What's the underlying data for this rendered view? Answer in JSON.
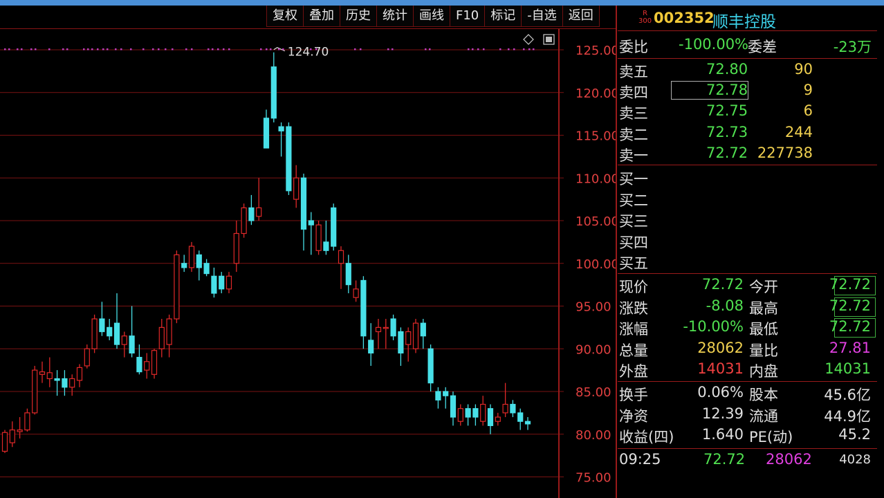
{
  "toolbar": [
    {
      "label": "复权"
    },
    {
      "label": "叠加"
    },
    {
      "label": "历史"
    },
    {
      "label": "统计"
    },
    {
      "label": "画线"
    },
    {
      "label": "F10"
    },
    {
      "label": "标记"
    },
    {
      "label": "-自选"
    },
    {
      "label": "返回"
    }
  ],
  "stock": {
    "badge_top": "R",
    "badge_bottom": "300",
    "code": "002352",
    "name": "顺丰控股"
  },
  "weibi": {
    "label1": "委比",
    "value1": "-100.00%",
    "label2": "委差",
    "value2": "-23万"
  },
  "asks": [
    {
      "label": "卖五",
      "price": "72.80",
      "volume": "90"
    },
    {
      "label": "卖四",
      "price": "72.78",
      "volume": "9"
    },
    {
      "label": "卖三",
      "price": "72.75",
      "volume": "6"
    },
    {
      "label": "卖二",
      "price": "72.73",
      "volume": "244"
    },
    {
      "label": "卖一",
      "price": "72.72",
      "volume": "227738"
    }
  ],
  "bids": [
    {
      "label": "买一"
    },
    {
      "label": "买二"
    },
    {
      "label": "买三"
    },
    {
      "label": "买四"
    },
    {
      "label": "买五"
    }
  ],
  "quote": {
    "xianjia_label": "现价",
    "xianjia": "72.72",
    "jinkai_label": "今开",
    "jinkai": "72.72",
    "zhangdie_label": "涨跌",
    "zhangdie": "-8.08",
    "zuigao_label": "最高",
    "zuigao": "72.72",
    "zhangfu_label": "涨幅",
    "zhangfu": "-10.00%",
    "zuidi_label": "最低",
    "zuidi": "72.72",
    "zongliang_label": "总量",
    "zongliang": "28062",
    "liangbi_label": "量比",
    "liangbi": "27.81",
    "waipan_label": "外盘",
    "waipan": "14031",
    "neipan_label": "内盘",
    "neipan": "14031"
  },
  "fund": {
    "huanshou_label": "换手",
    "huanshou": "0.06%",
    "guben_label": "股本",
    "guben": "45.6亿",
    "jingzi_label": "净资",
    "jingzi": "12.39",
    "liutong_label": "流通",
    "liutong": "44.9亿",
    "shouyi_label": "收益(四)",
    "shouyi": "1.640",
    "pe_label": "PE(动)",
    "pe": "45.2"
  },
  "tick": {
    "time": "09:25",
    "price": "72.72",
    "volume": "28062",
    "count": "4028"
  },
  "colors": {
    "up": "#e02828",
    "down": "#48e0e8",
    "grid": "#7a1212",
    "axis_text": "#e04040",
    "green": "#50e050",
    "yellow": "#f0d050"
  },
  "chart_data": {
    "type": "candlestick",
    "y_ticks": [
      "125.00",
      "120.00",
      "115.00",
      "110.00",
      "105.00",
      "100.00",
      "95.00",
      "90.00",
      "85.00",
      "80.00",
      "75.00"
    ],
    "ylim": [
      72.5,
      127
    ],
    "max_label": "124.70",
    "candles": [
      {
        "o": 78,
        "h": 80.5,
        "l": 77.8,
        "c": 80.2
      },
      {
        "o": 79,
        "h": 81.5,
        "l": 78.5,
        "c": 80.5
      },
      {
        "o": 80.3,
        "h": 82,
        "l": 79.5,
        "c": 80.5
      },
      {
        "o": 80.5,
        "h": 83,
        "l": 80.3,
        "c": 82.5
      },
      {
        "o": 82.5,
        "h": 88,
        "l": 82.3,
        "c": 87.5
      },
      {
        "o": 87,
        "h": 88.5,
        "l": 86,
        "c": 87.3
      },
      {
        "o": 86.5,
        "h": 89,
        "l": 85.5,
        "c": 87.2
      },
      {
        "o": 86.5,
        "h": 87.5,
        "l": 84.5,
        "c": 86.3
      },
      {
        "o": 86.5,
        "h": 87.5,
        "l": 84.5,
        "c": 85.5
      },
      {
        "o": 85.5,
        "h": 87,
        "l": 84.5,
        "c": 86.5
      },
      {
        "o": 86.3,
        "h": 88.2,
        "l": 85.5,
        "c": 87.8
      },
      {
        "o": 88,
        "h": 90.5,
        "l": 87.7,
        "c": 90
      },
      {
        "o": 90,
        "h": 94,
        "l": 89.5,
        "c": 93.5
      },
      {
        "o": 93.5,
        "h": 95.5,
        "l": 91.5,
        "c": 92
      },
      {
        "o": 92.5,
        "h": 93.5,
        "l": 91,
        "c": 91.5
      },
      {
        "o": 93,
        "h": 96.5,
        "l": 90,
        "c": 90.5
      },
      {
        "o": 90.5,
        "h": 92,
        "l": 89,
        "c": 91.5
      },
      {
        "o": 91.5,
        "h": 95,
        "l": 89,
        "c": 89.5
      },
      {
        "o": 89,
        "h": 90.5,
        "l": 87,
        "c": 87.3
      },
      {
        "o": 87.5,
        "h": 89.5,
        "l": 86.5,
        "c": 88.5
      },
      {
        "o": 87,
        "h": 90,
        "l": 86.5,
        "c": 89.8
      },
      {
        "o": 90,
        "h": 93.5,
        "l": 89,
        "c": 92.5
      },
      {
        "o": 90.5,
        "h": 94,
        "l": 89,
        "c": 93.5
      },
      {
        "o": 93.5,
        "h": 101.5,
        "l": 93,
        "c": 101
      },
      {
        "o": 100,
        "h": 101,
        "l": 99,
        "c": 99.5
      },
      {
        "o": 99.5,
        "h": 102.5,
        "l": 99,
        "c": 102
      },
      {
        "o": 101,
        "h": 101.5,
        "l": 98,
        "c": 99.5
      },
      {
        "o": 100,
        "h": 100.5,
        "l": 98.5,
        "c": 98.8
      },
      {
        "o": 98.5,
        "h": 99.5,
        "l": 96,
        "c": 96.5
      },
      {
        "o": 98.5,
        "h": 99,
        "l": 96.5,
        "c": 97
      },
      {
        "o": 97,
        "h": 99,
        "l": 96.5,
        "c": 98.5
      },
      {
        "o": 100,
        "h": 105,
        "l": 99,
        "c": 103.5
      },
      {
        "o": 103.5,
        "h": 107,
        "l": 103,
        "c": 106.5
      },
      {
        "o": 106.5,
        "h": 108,
        "l": 104.5,
        "c": 105
      },
      {
        "o": 105.5,
        "h": 110,
        "l": 105,
        "c": 106.5
      },
      {
        "o": 117,
        "h": 118,
        "l": 113.5,
        "c": 113.5
      },
      {
        "o": 123,
        "h": 124.7,
        "l": 116.5,
        "c": 117
      },
      {
        "o": 116,
        "h": 116.5,
        "l": 112.5,
        "c": 115.5
      },
      {
        "o": 116,
        "h": 116.5,
        "l": 108,
        "c": 108.5
      },
      {
        "o": 107.5,
        "h": 111.5,
        "l": 106.5,
        "c": 110
      },
      {
        "o": 110,
        "h": 110.5,
        "l": 101.5,
        "c": 104
      },
      {
        "o": 105,
        "h": 106,
        "l": 101,
        "c": 104.5
      },
      {
        "o": 101.5,
        "h": 105,
        "l": 101,
        "c": 104.5
      },
      {
        "o": 102.5,
        "h": 105,
        "l": 101,
        "c": 101.5
      },
      {
        "o": 106.5,
        "h": 107,
        "l": 101.5,
        "c": 102
      },
      {
        "o": 100,
        "h": 102,
        "l": 97,
        "c": 101.5
      },
      {
        "o": 100,
        "h": 101,
        "l": 96.5,
        "c": 97.5
      },
      {
        "o": 96,
        "h": 98,
        "l": 95.5,
        "c": 97
      },
      {
        "o": 98,
        "h": 98.5,
        "l": 90,
        "c": 91.5
      },
      {
        "o": 91,
        "h": 93,
        "l": 88,
        "c": 89.5
      },
      {
        "o": 92,
        "h": 93.5,
        "l": 90,
        "c": 92.5
      },
      {
        "o": 92.5,
        "h": 93.5,
        "l": 90,
        "c": 92.5
      },
      {
        "o": 93.5,
        "h": 94,
        "l": 91,
        "c": 91.5
      },
      {
        "o": 92,
        "h": 92.5,
        "l": 88,
        "c": 89.5
      },
      {
        "o": 90.5,
        "h": 92.5,
        "l": 88.5,
        "c": 92
      },
      {
        "o": 90,
        "h": 93.5,
        "l": 89.5,
        "c": 93
      },
      {
        "o": 93,
        "h": 93.5,
        "l": 90,
        "c": 91.5
      },
      {
        "o": 90,
        "h": 90.5,
        "l": 85,
        "c": 86
      },
      {
        "o": 85,
        "h": 85.5,
        "l": 83,
        "c": 84
      },
      {
        "o": 85,
        "h": 85.5,
        "l": 83,
        "c": 84.5
      },
      {
        "o": 84.5,
        "h": 85,
        "l": 81,
        "c": 82
      },
      {
        "o": 81.5,
        "h": 83.5,
        "l": 81,
        "c": 83
      },
      {
        "o": 83,
        "h": 83.5,
        "l": 81,
        "c": 82
      },
      {
        "o": 83,
        "h": 83.5,
        "l": 81,
        "c": 82
      },
      {
        "o": 81.5,
        "h": 84.5,
        "l": 81,
        "c": 83.5
      },
      {
        "o": 83,
        "h": 83.5,
        "l": 80,
        "c": 81
      },
      {
        "o": 81.5,
        "h": 82.5,
        "l": 81,
        "c": 82
      },
      {
        "o": 82.5,
        "h": 86,
        "l": 82,
        "c": 83.5
      },
      {
        "o": 83.5,
        "h": 84,
        "l": 82,
        "c": 82.5
      },
      {
        "o": 82.5,
        "h": 83,
        "l": 80.5,
        "c": 81.5
      },
      {
        "o": 81.5,
        "h": 82,
        "l": 80.5,
        "c": 81.2
      }
    ]
  }
}
